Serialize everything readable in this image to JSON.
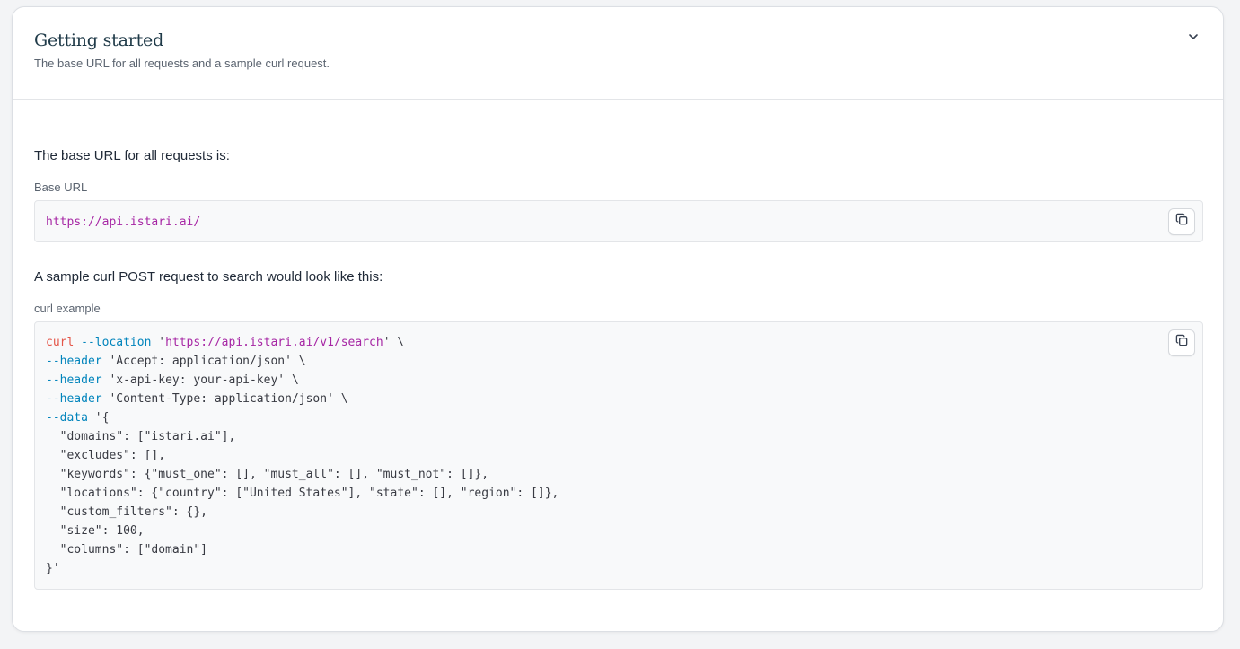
{
  "header": {
    "title": "Getting started",
    "subtitle": "The base URL for all requests and a sample curl request.",
    "toggle_icon": "chevron-down-icon"
  },
  "base_url_section": {
    "lead": "The base URL for all requests is:",
    "label": "Base URL",
    "url": "https://api.istari.ai/",
    "copy_icon": "copy-icon"
  },
  "curl_section": {
    "lead": "A sample curl POST request to search would look like this:",
    "label": "curl example",
    "copy_icon": "copy-icon",
    "lines": [
      {
        "cmd": "curl",
        "flag": " --location",
        "pre": " '",
        "url": "https://api.istari.ai/v1/search",
        "post": "' \\"
      },
      {
        "flag": "--header",
        "text": " 'Accept: application/json' \\"
      },
      {
        "flag": "--header",
        "text": " 'x-api-key: your-api-key' \\"
      },
      {
        "flag": "--header",
        "text": " 'Content-Type: application/json' \\"
      },
      {
        "flag": "--data",
        "text": " '{"
      },
      {
        "text": "  \"domains\": [\"istari.ai\"],"
      },
      {
        "text": "  \"excludes\": [],"
      },
      {
        "text": "  \"keywords\": {\"must_one\": [], \"must_all\": [], \"must_not\": []},"
      },
      {
        "text": "  \"locations\": {\"country\": [\"United States\"], \"state\": [], \"region\": []},"
      },
      {
        "text": "  \"custom_filters\": {},"
      },
      {
        "text": "  \"size\": 100,"
      },
      {
        "text": "  \"columns\": [\"domain\"]"
      },
      {
        "text": "}'"
      }
    ]
  },
  "colors": {
    "title": "#1f3a48",
    "cmd": "#e45649",
    "flag": "#0184bc",
    "url": "#a626a4",
    "code_bg": "#f8f9fa"
  }
}
